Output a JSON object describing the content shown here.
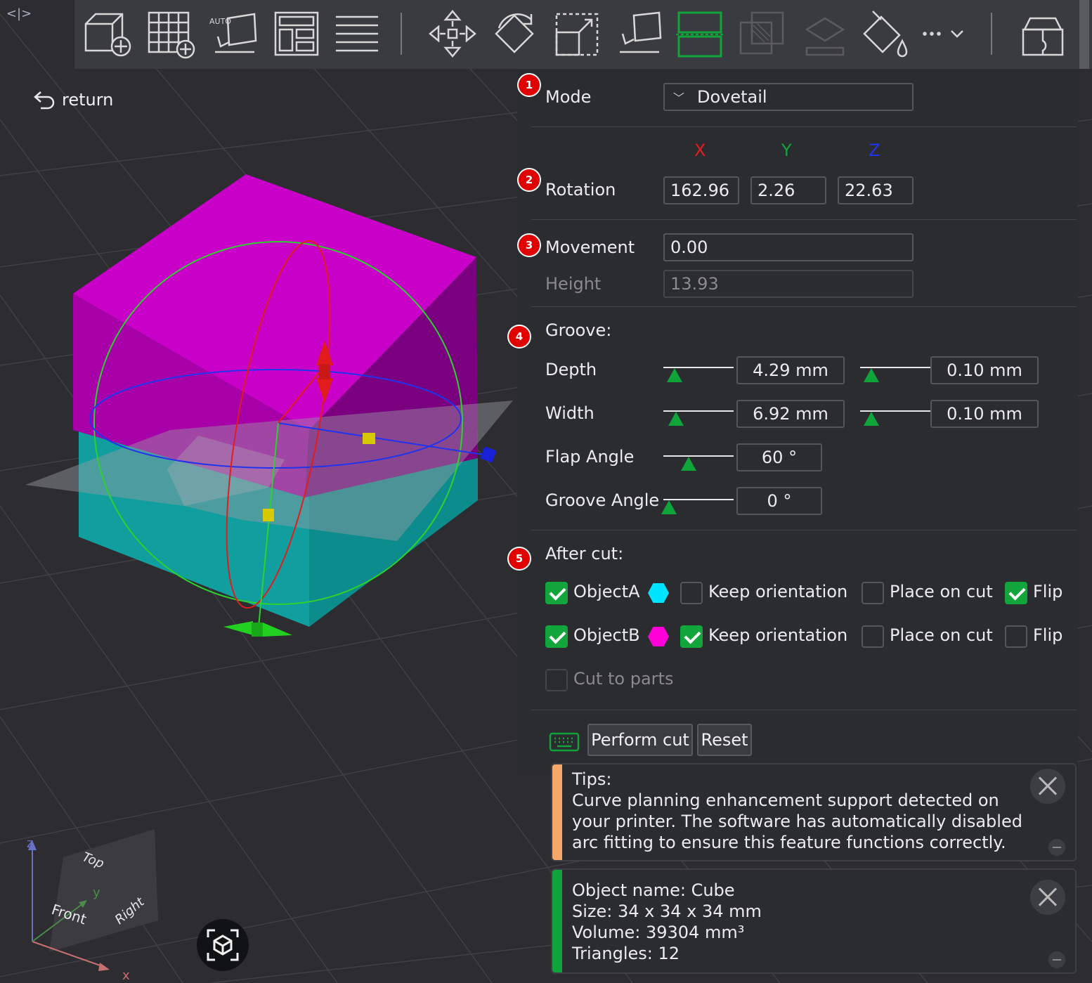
{
  "toolbar": {
    "items": [
      {
        "name": "add-cube",
        "icon": "cube-plus-icon"
      },
      {
        "name": "add-plate",
        "icon": "grid-plus-icon"
      },
      {
        "name": "auto-orient",
        "icon": "auto-orient-icon",
        "badge": "AUTO"
      },
      {
        "name": "arrange",
        "icon": "arrange-icon"
      },
      {
        "name": "layers",
        "icon": "layers-icon"
      },
      {
        "name": "move",
        "icon": "move-icon"
      },
      {
        "name": "rotate",
        "icon": "rotate-icon"
      },
      {
        "name": "scale",
        "icon": "scale-icon"
      },
      {
        "name": "lay-on-face",
        "icon": "lay-on-face-icon"
      },
      {
        "name": "cut",
        "icon": "cut-icon",
        "active": true
      },
      {
        "name": "boolean",
        "icon": "boolean-icon",
        "disabled": true
      },
      {
        "name": "split",
        "icon": "split-icon",
        "disabled": true
      },
      {
        "name": "paint",
        "icon": "paint-bucket-icon"
      },
      {
        "name": "more",
        "icon": "more-chevron-icon",
        "label": "···"
      },
      {
        "name": "assembly",
        "icon": "assembly-icon"
      }
    ]
  },
  "return_label": "return",
  "cut": {
    "mode_label": "Mode",
    "mode_value": "Dovetail",
    "axes": {
      "x": "X",
      "y": "Y",
      "z": "Z"
    },
    "rotation_label": "Rotation",
    "rotation": {
      "x": "162.96",
      "y": "2.26",
      "z": "22.63"
    },
    "movement_label": "Movement",
    "movement_value": "0.00",
    "height_label": "Height",
    "height_value": "13.93",
    "groove_label": "Groove:",
    "depth_label": "Depth",
    "depth_value": "4.29  mm",
    "depth_tolerance": "0.10  mm",
    "depth_level": 0.1,
    "depth_tol_level": 0.1,
    "width_label": "Width",
    "width_value": "6.92  mm",
    "width_tolerance": "0.10  mm",
    "width_level": 0.12,
    "width_tol_level": 0.1,
    "flap_label": "Flap Angle",
    "flap_value": "60 °",
    "flap_level": 0.3,
    "groove_angle_label": "Groove Angle",
    "groove_angle_value": "0 °",
    "groove_angle_level": 0.02,
    "after_cut_label": "After cut:",
    "objA": {
      "label": "ObjectA",
      "color": "#00e5ff",
      "checked": true,
      "keep_orientation": false,
      "place_on_cut": false,
      "flip": true
    },
    "objB": {
      "label": "ObjectB",
      "color": "#ff00d8",
      "checked": true,
      "keep_orientation": true,
      "place_on_cut": false,
      "flip": false
    },
    "keep_orientation_label": "Keep orientation",
    "place_on_cut_label": "Place on cut",
    "flip_label": "Flip",
    "cut_to_parts_label": "Cut to parts",
    "perform_cut_label": "Perform cut",
    "reset_label": "Reset",
    "badges": [
      "1",
      "2",
      "3",
      "4",
      "5"
    ]
  },
  "tips": {
    "title": "Tips:",
    "lines": [
      "Curve planning enhancement support detected on",
      "your printer. The software has automatically disabled",
      "arc fitting to ensure this feature functions correctly."
    ],
    "color": "#f7a86b"
  },
  "object_info": {
    "name_line": "Object name: Cube",
    "size_line": "Size: 34 x 34 x 34 mm",
    "volume_line": "Volume: 39304 mm³",
    "triangles_line": "Triangles: 12",
    "color": "#10a53a"
  },
  "view_cube": {
    "top": "Top",
    "front": "Front",
    "right": "Right",
    "axis_x": "x",
    "axis_y": "y",
    "axis_z": "z"
  },
  "colors": {
    "part_a": "#10a6a6",
    "part_b": "#c000c0",
    "accent": "#10a53a"
  }
}
